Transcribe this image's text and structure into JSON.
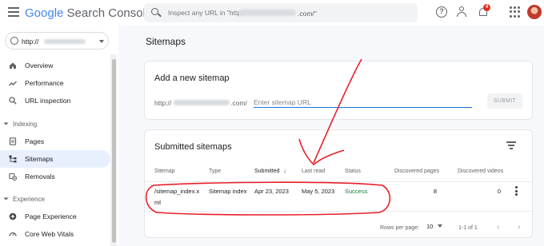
{
  "app": {
    "logo_google": "Google",
    "logo_product": "Search Console"
  },
  "search": {
    "placeholder": "Inspect any URL in \"http://",
    "placeholder_suffix": ".com/\""
  },
  "topbar": {
    "help_glyph": "?",
    "notification_count": "4"
  },
  "property": {
    "label": "http://"
  },
  "sidebar": {
    "items": [
      {
        "label": "Overview",
        "icon": "home-icon"
      },
      {
        "label": "Performance",
        "icon": "trending-up-icon"
      },
      {
        "label": "URL inspection",
        "icon": "search-icon"
      },
      {
        "label": "Pages",
        "icon": "page-icon"
      },
      {
        "label": "Sitemaps",
        "icon": "sitemap-icon"
      },
      {
        "label": "Removals",
        "icon": "removal-icon"
      },
      {
        "label": "Page Experience",
        "icon": "plus-circle-icon"
      },
      {
        "label": "Core Web Vitals",
        "icon": "speed-icon"
      }
    ],
    "sections": {
      "indexing": "Indexing",
      "experience": "Experience"
    }
  },
  "main": {
    "title": "Sitemaps",
    "add_card": {
      "title": "Add a new sitemap",
      "prefix": "http://",
      "suffix": ".com/",
      "input_placeholder": "Enter sitemap URL",
      "submit_label": "SUBMIT"
    },
    "submitted_card": {
      "title": "Submitted sitemaps",
      "columns": [
        "Sitemap",
        "Type",
        "Submitted",
        "Last read",
        "Status",
        "Discovered pages",
        "Discovered videos"
      ],
      "rows": [
        {
          "sitemap_line1": "/sitemap_index.x",
          "sitemap_line2": "ml",
          "type": "Sitemap index",
          "submitted": "Apr 23, 2023",
          "last_read": "May 5, 2023",
          "status": "Success",
          "discovered_pages": "8",
          "discovered_videos": "0"
        }
      ],
      "pagination": {
        "rows_per_page_label": "Rows per page:",
        "rows_per_page_value": "10",
        "range": "1-1 of 1"
      }
    }
  },
  "colors": {
    "accent": "#1a73e8",
    "success": "#188038",
    "annotation": "#e8202a",
    "active_nav": "#e8f0fe"
  }
}
